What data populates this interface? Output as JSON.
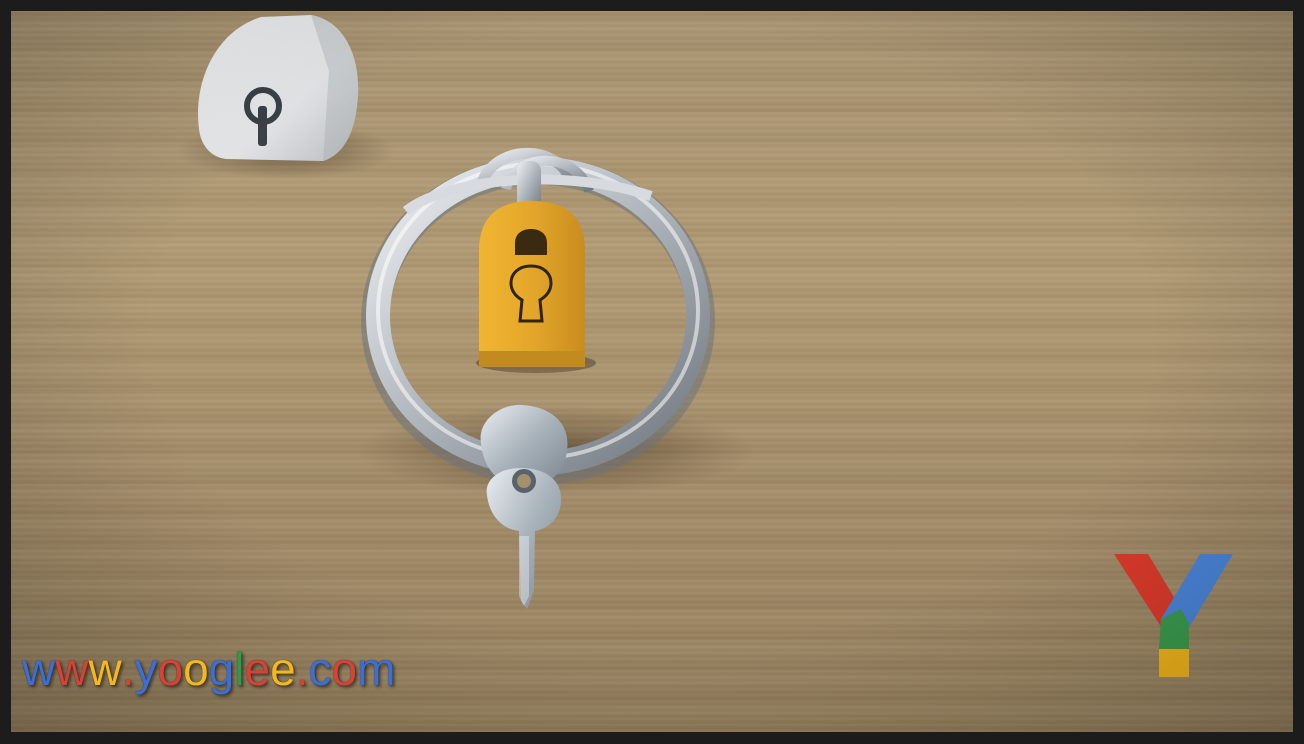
{
  "watermark": {
    "text": "www.yooglee.com",
    "letter_colors": [
      "#3b6fd6",
      "#d64236",
      "#f2b81f",
      "#d64236",
      "#3b6fd6",
      "#d64236",
      "#f2b81f",
      "#3b6fd6",
      "#2e9b4a",
      "#d64236",
      "#f2b81f",
      "#d64236",
      "#3b6fd6",
      "#d64236",
      "#3b6fd6"
    ]
  },
  "logo": {
    "letter": "Y",
    "colors": {
      "left": "#d93a2b",
      "right": "#4a84d8",
      "stem_top": "#3a9a4e",
      "stem_bottom": "#f0b41c"
    }
  },
  "scene": {
    "icons": [
      "white-lock-icon",
      "key-ring-icon",
      "yellow-padlock-icon",
      "keyhole-icon",
      "key-icon"
    ],
    "colors": {
      "wood": "#a7926f",
      "padlock": "#e5a82b",
      "ring": "#c9ced3",
      "shell": "#e8e9ea"
    }
  }
}
